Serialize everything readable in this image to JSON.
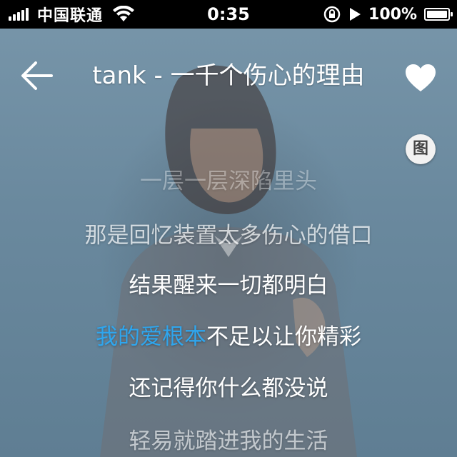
{
  "status_bar": {
    "carrier": "中国联通",
    "time": "0:35",
    "battery_percent": "100%",
    "signal_bars": 5,
    "battery_level": 1.0,
    "icons": [
      "signal-icon",
      "wifi-icon",
      "rotation-lock-icon",
      "play-icon",
      "battery-icon"
    ]
  },
  "header": {
    "title": "tank - 一千个伤心的理由",
    "back_icon": "arrow-left-icon",
    "favorite_icon": "heart-icon"
  },
  "picture_button": {
    "label": "图"
  },
  "lyrics": {
    "lines": [
      "一层一层深陷里头",
      "那是回忆装置太多伤心的借口",
      "结果醒来一切都明白",
      {
        "sung": "我的爱根本",
        "unsung": "不足以让你精彩"
      },
      "还记得你什么都没说",
      "轻易就踏进我的生活"
    ],
    "highlight_color": "#2fa6ee"
  }
}
